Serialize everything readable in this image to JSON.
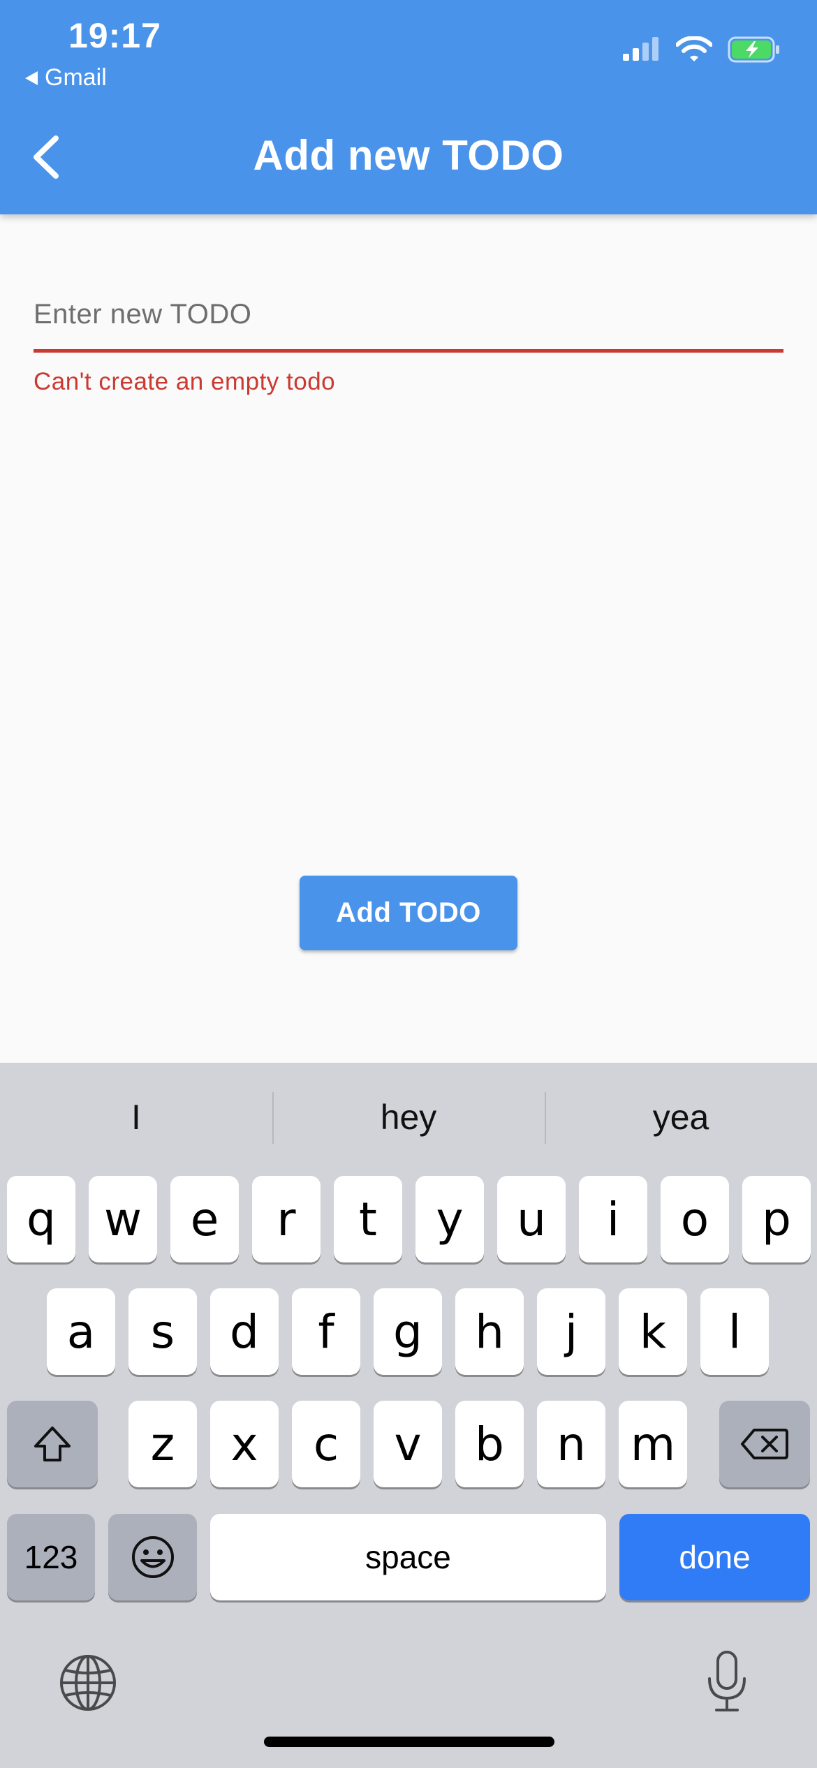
{
  "status_bar": {
    "time": "19:17",
    "back_app": "Gmail"
  },
  "app_bar": {
    "title": "Add new TODO",
    "back_icon": "chevron-left-icon",
    "color": "#4a93ea"
  },
  "form": {
    "input_placeholder": "Enter new TODO",
    "input_value": "",
    "error_text": "Can't create an empty todo",
    "error_color": "#c93a32"
  },
  "add_button": {
    "label": "Add TODO"
  },
  "keyboard": {
    "suggestions": [
      "I",
      "hey",
      "yea"
    ],
    "row1": [
      "q",
      "w",
      "e",
      "r",
      "t",
      "y",
      "u",
      "i",
      "o",
      "p"
    ],
    "row2": [
      "a",
      "s",
      "d",
      "f",
      "g",
      "h",
      "j",
      "k",
      "l"
    ],
    "row3": [
      "z",
      "x",
      "c",
      "v",
      "b",
      "n",
      "m"
    ],
    "numbers_label": "123",
    "space_label": "space",
    "done_label": "done",
    "done_color": "#2f7cf6"
  }
}
